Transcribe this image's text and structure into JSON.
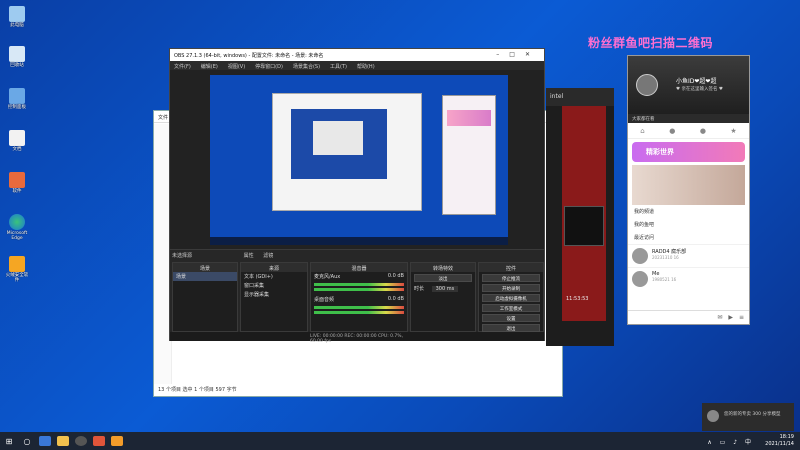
{
  "desktop": {
    "headline": "粉丝群鱼吧扫描二维码",
    "icons": [
      {
        "label": "此电脑",
        "name": "this-pc"
      },
      {
        "label": "回收站",
        "name": "recycle-bin"
      },
      {
        "label": "控制面板",
        "name": "control-panel"
      },
      {
        "label": "文档",
        "name": "documents"
      },
      {
        "label": "软件",
        "name": "software"
      },
      {
        "label": "Microsoft Edge",
        "name": "edge"
      },
      {
        "label": "火绒安全软件",
        "name": "huorong"
      }
    ]
  },
  "obs": {
    "title": "OBS 27.1.3 (64-bit, windows) - 配置文件: 未命名 - 场景: 未命名",
    "menu": [
      "文件(F)",
      "编辑(E)",
      "视图(V)",
      "停靠窗口(D)",
      "场景集合(S)",
      "工具(T)",
      "帮助(H)"
    ],
    "scene_toolbar": {
      "label": "未选择源",
      "props": "属性",
      "filters": "滤镜"
    },
    "docks": {
      "scenes": {
        "title": "场景",
        "items": [
          "场景"
        ]
      },
      "sources": {
        "title": "来源",
        "items": [
          "文本 (GDI+)",
          "窗口采集",
          "显示器采集"
        ]
      },
      "mixer": {
        "title": "混音器",
        "tracks": [
          {
            "name": "麦克风/Aux",
            "db": "0.0 dB"
          },
          {
            "name": "桌面音频",
            "db": "0.0 dB"
          }
        ]
      },
      "transitions": {
        "title": "转场特效",
        "type": "淡出",
        "duration_label": "时长",
        "duration": "300 ms"
      },
      "controls": {
        "title": "控件",
        "buttons": [
          "停止推流",
          "开始录制",
          "启动虚拟摄像机",
          "工作室模式",
          "设置",
          "退出"
        ]
      }
    },
    "status": "LIVE: 00:00:00   REC: 00:00:00   CPU: 0.7%, 60.00 fps"
  },
  "explorer": {
    "tab": "文件",
    "status": "13 个项目   选中 1 个项目 597 字节"
  },
  "darkwin": {
    "brand": "intel",
    "time": "11:53:53"
  },
  "phone_app": {
    "username": "小鱼ID❤超❤超",
    "signature": "♥ 亲在这里输入签名 ♥",
    "tabbar": "大家都在看",
    "banner": "精彩世界",
    "list": [
      "我的頻道",
      "我的鱼吧",
      "最近访问"
    ],
    "chats": [
      {
        "name": "RADD4 腐乐部",
        "sub": "20231310   16"
      },
      {
        "name": "Me",
        "sub": "1980521   16"
      }
    ]
  },
  "toast": {
    "text": "您的新的专卖 300 分享模型"
  },
  "taskbar": {
    "time": "18:19",
    "date": "2021/11/14"
  },
  "colors": {
    "headline": "#ff6fd0",
    "desktop": "#0b5bd4",
    "obs_bg": "#222222"
  }
}
